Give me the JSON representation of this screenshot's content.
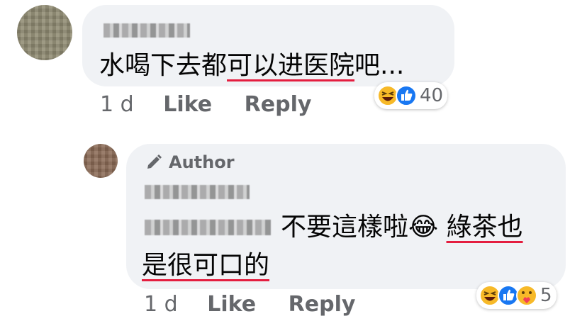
{
  "comments": [
    {
      "text_plain": "水喝下去都",
      "text_underlined": "可以进医院",
      "text_tail": "吧...",
      "time": "1 d",
      "like_label": "Like",
      "reply_label": "Reply",
      "reactions": {
        "icons": [
          "haha-icon",
          "like-icon"
        ],
        "count": "40"
      }
    },
    {
      "author_badge": "Author",
      "text_line1": "不要這樣啦😂",
      "text_line1_underlined": "綠茶也",
      "text_line2_underlined": "是很可口的",
      "time": "1 d",
      "like_label": "Like",
      "reply_label": "Reply",
      "reactions": {
        "icons": [
          "haha-icon",
          "like-icon",
          "care-icon"
        ],
        "count": "5"
      }
    }
  ],
  "colors": {
    "bubble": "#f0f2f5",
    "meta_text": "#65676b",
    "underline": "#e41e3f",
    "like_blue": "#1877f2",
    "haha_yellow": "#f7b928"
  }
}
